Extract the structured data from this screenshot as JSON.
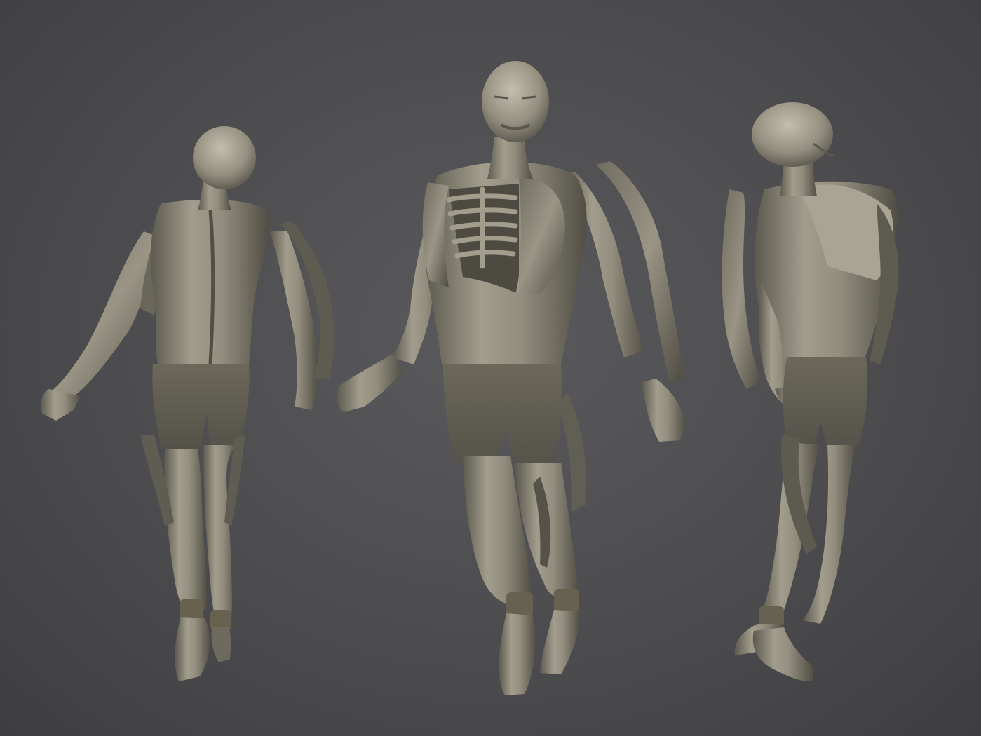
{
  "scene": {
    "background_color": "#4a4a4d",
    "clay_color": "#8c8878",
    "clay_highlight": "#b5b0a0",
    "clay_shadow": "#4e4b42",
    "figures": [
      {
        "name": "back-view"
      },
      {
        "name": "front-view"
      },
      {
        "name": "side-view"
      }
    ]
  }
}
